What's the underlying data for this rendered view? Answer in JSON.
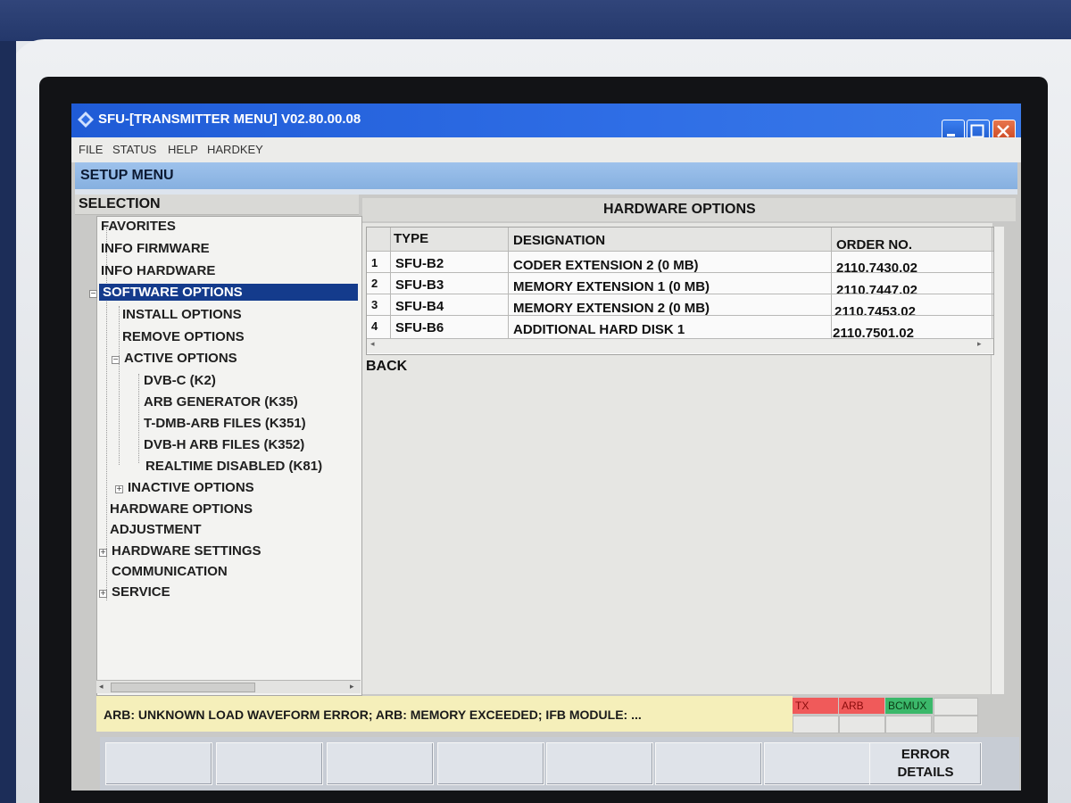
{
  "window": {
    "title": "SFU-[TRANSMITTER MENU]  V02.80.00.08"
  },
  "menubar": [
    "FILE",
    "STATUS",
    "HELP",
    "HARDKEY"
  ],
  "setup_menu": {
    "header": "SETUP MENU",
    "selection_header": "SELECTION"
  },
  "tree": [
    {
      "label": "FAVORITES"
    },
    {
      "label": "INFO FIRMWARE"
    },
    {
      "label": "INFO HARDWARE"
    },
    {
      "label": "SOFTWARE OPTIONS",
      "selected": true
    },
    {
      "label": "INSTALL OPTIONS"
    },
    {
      "label": "REMOVE OPTIONS"
    },
    {
      "label": "ACTIVE OPTIONS"
    },
    {
      "label": "DVB-C (K2)"
    },
    {
      "label": "ARB GENERATOR (K35)"
    },
    {
      "label": "T-DMB-ARB FILES (K351)"
    },
    {
      "label": "DVB-H ARB FILES (K352)"
    },
    {
      "label": "REALTIME DISABLED (K81)"
    },
    {
      "label": "INACTIVE OPTIONS"
    },
    {
      "label": "HARDWARE OPTIONS"
    },
    {
      "label": "ADJUSTMENT"
    },
    {
      "label": "HARDWARE SETTINGS"
    },
    {
      "label": "COMMUNICATION"
    },
    {
      "label": "SERVICE"
    }
  ],
  "hardware_options": {
    "title": "HARDWARE OPTIONS",
    "columns": [
      "TYPE",
      "DESIGNATION",
      "ORDER NO."
    ],
    "rows": [
      {
        "n": "1",
        "type": "SFU-B2",
        "designation": "CODER EXTENSION 2 (0 MB)",
        "order_no": "2110.7430.02"
      },
      {
        "n": "2",
        "type": "SFU-B3",
        "designation": "MEMORY EXTENSION 1 (0 MB)",
        "order_no": "2110.7447.02"
      },
      {
        "n": "3",
        "type": "SFU-B4",
        "designation": "MEMORY EXTENSION 2 (0 MB)",
        "order_no": "2110.7453.02"
      },
      {
        "n": "4",
        "type": "SFU-B6",
        "designation": "ADDITIONAL HARD DISK 1",
        "order_no": "2110.7501.02"
      }
    ],
    "back_label": "BACK"
  },
  "status": {
    "message": "ARB: UNKNOWN LOAD WAVEFORM ERROR; ARB: MEMORY EXCEEDED; IFB MODULE: ...",
    "indicators": [
      {
        "label": "TX",
        "color": "#f05a5a"
      },
      {
        "label": "ARB",
        "color": "#f05a5a"
      },
      {
        "label": "BCMUX",
        "color": "#3bb86a"
      }
    ]
  },
  "softkeys": [
    "",
    "",
    "",
    "",
    "",
    "",
    "",
    "ERROR DETAILS"
  ],
  "colors": {
    "titlebar": "#1f5bd6",
    "selection_highlight": "#143b8c",
    "status_bar": "#f5efba"
  }
}
